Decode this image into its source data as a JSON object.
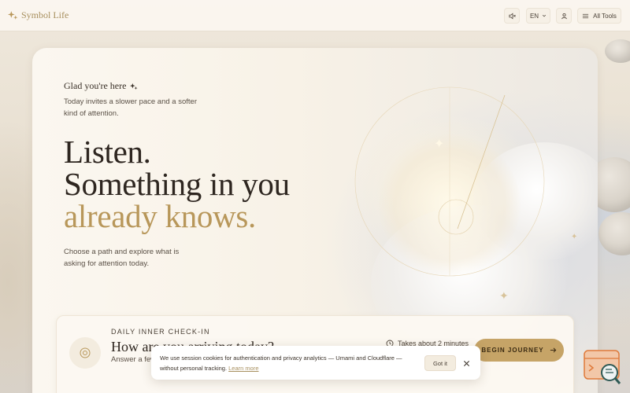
{
  "topbar": {
    "brand": "Symbol Life",
    "sound_icon": "speaker-muted-icon",
    "language": "EN",
    "account_icon": "user-icon",
    "all_tools": "All Tools"
  },
  "hero": {
    "greeting": "Glad you're here",
    "intro": "Today invites a slower pace and a softer kind of attention.",
    "headline_line1": "Listen.",
    "headline_line2": "Something in you",
    "headline_line3": "already knows.",
    "choose": "Choose a path and explore what is asking for attention today."
  },
  "checkin": {
    "label": "DAILY INNER CHECK-IN",
    "title": "How are you arriving today?",
    "description": "Answer a few questions about your vitality, emotions",
    "time": "Takes about 2 minutes",
    "begin": "BEGIN JOURNEY"
  },
  "cookie": {
    "text": "We use session cookies for authentication and privacy analytics — Umami and Cloudflare — without personal tracking.",
    "link": "Learn more",
    "got_it": "Got it"
  },
  "colors": {
    "accent_gold": "#b8975a",
    "button_gold": "#c6a467",
    "text_dark": "#2e2620"
  }
}
